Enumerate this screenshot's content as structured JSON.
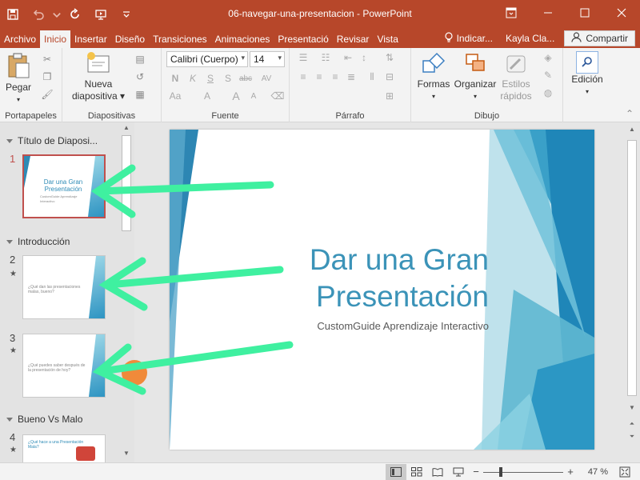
{
  "window": {
    "title": "06-navegar-una-presentacion - PowerPoint"
  },
  "quick_access": {
    "save_icon": "save-icon",
    "undo_icon": "undo-icon",
    "redo_icon": "repeat-icon",
    "present_icon": "present-from-start-icon",
    "customize_icon": "customize-toolbar-icon"
  },
  "tabs": [
    "Archivo",
    "Inicio",
    "Insertar",
    "Diseño",
    "Transiciones",
    "Animaciones",
    "Presentació",
    "Revisar",
    "Vista"
  ],
  "tell_me": "Indicar...",
  "user": "Kayla Cla...",
  "share": "Compartir",
  "ribbon": {
    "clipboard": {
      "label": "Portapapeles",
      "paste": "Pegar"
    },
    "slides": {
      "label": "Diapositivas",
      "new_slide_line1": "Nueva",
      "new_slide_line2": "diapositiva"
    },
    "font": {
      "label": "Fuente",
      "font_name": "Calibri (Cuerpo)",
      "font_size": "14",
      "bold": "N",
      "italic": "K",
      "underline": "S",
      "shadow": "S",
      "strikethrough": "abc",
      "spacing": "AV",
      "case": "Aa",
      "grow": "A",
      "shrink": "A"
    },
    "paragraph": {
      "label": "Párrafo"
    },
    "drawing": {
      "label": "Dibujo",
      "shapes": "Formas",
      "arrange": "Organizar",
      "styles_line1": "Estilos",
      "styles_line2": "rápidos"
    },
    "editing": {
      "label": "Edición"
    }
  },
  "panel": {
    "sections": [
      {
        "title": "Título de Diaposi..."
      },
      {
        "title": "Introducción"
      },
      {
        "title": "Bueno Vs Malo"
      }
    ],
    "slides": [
      {
        "number": "1",
        "title": "Dar una Gran Presentación",
        "subtitle": "CustomGuide Aprendizaje Interactivo"
      },
      {
        "number": "2",
        "title": "",
        "subtitle": "¿Qué dan las presentaciones malas, bueno?"
      },
      {
        "number": "3",
        "title": "",
        "subtitle": "¿Qué puedes saber después de la presentación de hoy?"
      },
      {
        "number": "4",
        "title": "",
        "subtitle": "¿Qué hace a una Presentación Mala?"
      }
    ]
  },
  "slide": {
    "title_line1": "Dar una Gran",
    "title_line2": "Presentación",
    "subtitle": "CustomGuide Aprendizaje Interactivo"
  },
  "status": {
    "zoom": "47 %",
    "zoom_fraction": 0.47
  },
  "colors": {
    "accent": "#b7472a",
    "slide_blue": "#3b93b8",
    "annotation_green": "#3ff0a0",
    "selection": "#c0504d"
  }
}
